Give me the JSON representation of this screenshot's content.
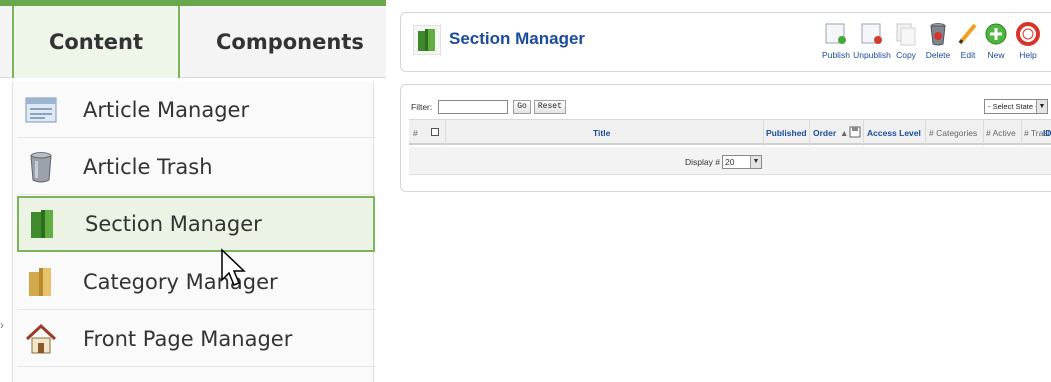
{
  "menu": {
    "tabs": [
      {
        "label": "Content"
      },
      {
        "label": "Components"
      }
    ],
    "dropdown": [
      {
        "label": "Article Manager",
        "icon": "article-manager-icon"
      },
      {
        "label": "Article Trash",
        "icon": "trash-can-icon"
      },
      {
        "label": "Section Manager",
        "icon": "section-manager-icon",
        "state": "hovered"
      },
      {
        "label": "Category Manager",
        "icon": "category-manager-icon"
      },
      {
        "label": "Front Page Manager",
        "icon": "house-icon"
      }
    ]
  },
  "section_manager": {
    "title": "Section Manager",
    "toolbar": [
      {
        "label": "Publish",
        "icon": "publish-icon"
      },
      {
        "label": "Unpublish",
        "icon": "unpublish-icon"
      },
      {
        "label": "Copy",
        "icon": "copy-icon"
      },
      {
        "label": "Delete",
        "icon": "delete-icon"
      },
      {
        "label": "Edit",
        "icon": "edit-icon"
      },
      {
        "label": "New",
        "icon": "new-icon"
      },
      {
        "label": "Help",
        "icon": "help-icon"
      }
    ],
    "filter": {
      "label": "Filter:",
      "value": "",
      "go_label": "Go",
      "reset_label": "Reset",
      "state_select": "- Select State -"
    },
    "columns": {
      "num": "#",
      "title": "Title",
      "published": "Published",
      "order": "Order",
      "access": "Access Level",
      "categories": "# Categories",
      "active": "# Active",
      "trash": "# Trash",
      "id": "ID"
    },
    "footer": {
      "display_label": "Display #",
      "display_value": "20"
    }
  },
  "colors": {
    "accent_green": "#7db35c",
    "link_blue": "#1b4c9b"
  }
}
